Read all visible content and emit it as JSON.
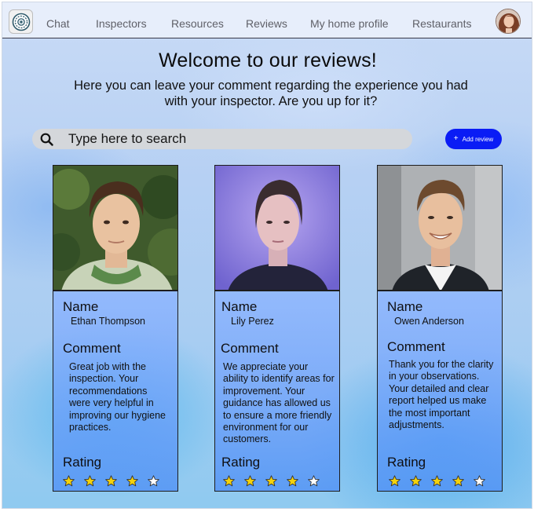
{
  "nav": {
    "links": [
      "Chat",
      "Inspectors",
      "Resources",
      "Reviews",
      "My home profile",
      "Restaurants"
    ]
  },
  "page": {
    "title": "Welcome to our reviews!",
    "subtitle": "Here you can leave your comment regarding the experience you had with your inspector. Are you up for it?"
  },
  "search": {
    "placeholder": "Type here to search"
  },
  "add_review": {
    "label": "Add review"
  },
  "card_labels": {
    "name": "Name",
    "comment": "Comment",
    "rating": "Rating"
  },
  "reviews": [
    {
      "name": "Ethan Thompson",
      "comment": "Great job with the inspection. Your recommendations were very helpful in improving our hygiene practices.",
      "rating": 4,
      "max_rating": 5
    },
    {
      "name": "Lily Perez",
      "comment": "We appreciate your ability to identify areas for improvement. Your guidance has allowed us to ensure a more friendly environment for our customers.",
      "rating": 4,
      "max_rating": 5
    },
    {
      "name": "Owen Anderson",
      "comment": "Thank you for the clarity in your observations. Your detailed and clear report helped us make the most important adjustments.",
      "rating": 4,
      "max_rating": 5
    }
  ],
  "colors": {
    "accent": "#0a1cf5",
    "star_filled": "#f4d20c",
    "star_empty": "#ffffff"
  }
}
